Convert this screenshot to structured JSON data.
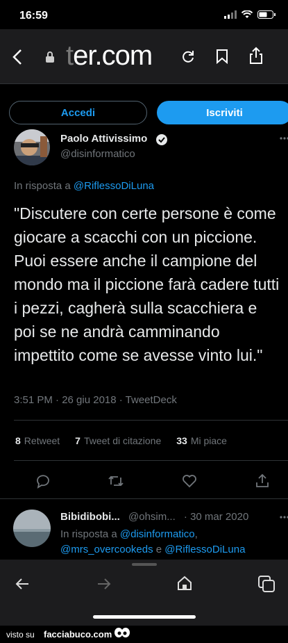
{
  "status": {
    "time": "16:59"
  },
  "browser": {
    "url_faded": "t",
    "url": "er.com"
  },
  "buttons": {
    "login": "Accedi",
    "signup": "Iscriviti"
  },
  "tweet": {
    "author_name": "Paolo Attivissimo",
    "author_handle": "@disinformatico",
    "reply_prefix": "In risposta a",
    "reply_to": "@RiflessoDiLuna",
    "text": "\"Discutere con certe persone è come giocare a scacchi con un piccione. Puoi essere anche il campione del mondo ma il piccione farà cadere tutti i pezzi, cagherà sulla scacchiera e poi se ne andrà camminando impettito come se avesse vinto lui.\"",
    "time": "3:51 PM · 26 giu 2018 · TweetDeck",
    "retweets": "8",
    "retweets_label": "Retweet",
    "quotes": "7",
    "quotes_label": "Tweet di citazione",
    "likes": "33",
    "likes_label": "Mi piace"
  },
  "reply": {
    "author_name": "Bibidibobi...",
    "author_handle": "@ohsim...",
    "date": "· 30 mar 2020",
    "reply_prefix": "In risposta a",
    "mention1": "@disinformatico",
    "mention2": "@mrs_overcookeds",
    "conj": "e",
    "mention3": "@RiflessoDiLuna"
  },
  "footer": {
    "seen_on": "visto su",
    "site": "facciabuco.com"
  }
}
